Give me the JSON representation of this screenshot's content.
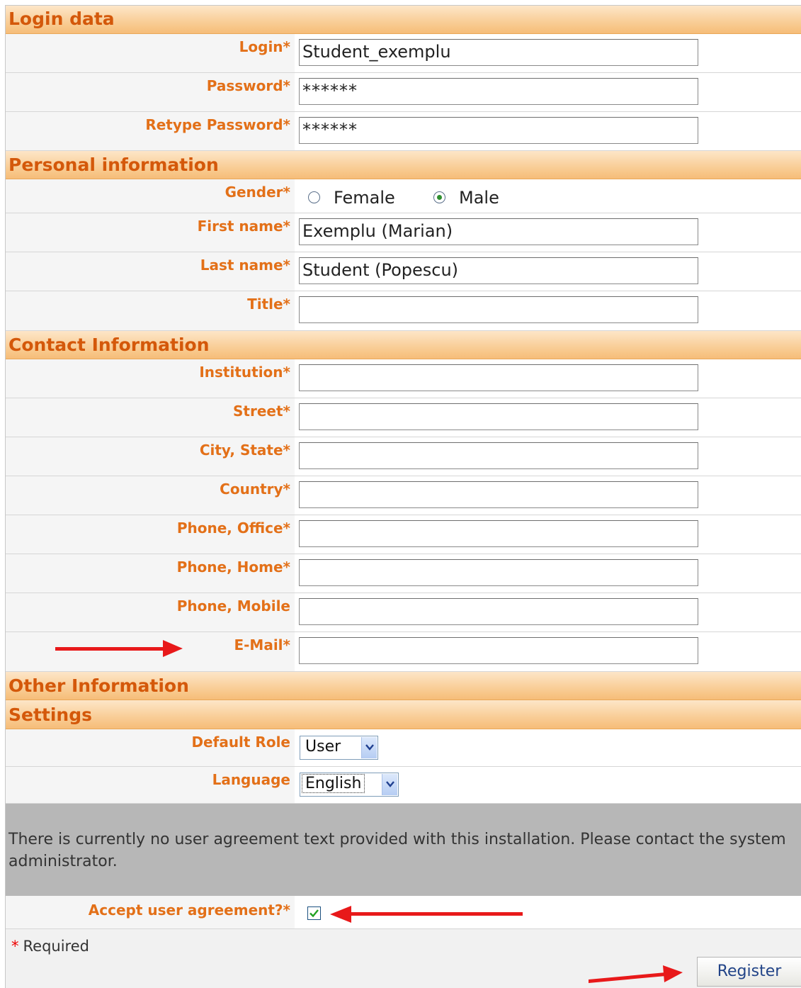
{
  "sections": {
    "login": "Login data",
    "personal": "Personal information",
    "contact": "Contact Information",
    "other": "Other Information",
    "settings": "Settings"
  },
  "login": {
    "login_label": "Login*",
    "login_value": "Student_exemplu",
    "password_label": "Password*",
    "password_value": "******",
    "retype_label": "Retype Password*",
    "retype_value": "******"
  },
  "personal": {
    "gender_label": "Gender*",
    "gender_options": [
      "Female",
      "Male"
    ],
    "gender_selected": "Male",
    "first_name_label": "First name*",
    "first_name_value": "Exemplu (Marian)",
    "last_name_label": "Last name*",
    "last_name_value": "Student (Popescu)",
    "title_label": "Title*",
    "title_value": ""
  },
  "contact": {
    "institution_label": "Institution*",
    "street_label": "Street*",
    "city_label": "City, State*",
    "country_label": "Country*",
    "phone_office_label": "Phone, Office*",
    "phone_home_label": "Phone, Home*",
    "phone_mobile_label": "Phone, Mobile",
    "email_label": "E-Mail*"
  },
  "settings": {
    "role_label": "Default Role",
    "role_value": "User",
    "language_label": "Language",
    "language_value": "English"
  },
  "agreement": {
    "text": "There is currently no user agreement text provided with this installation. Please contact the system administrator.",
    "accept_label": "Accept user agreement?*",
    "accepted": true
  },
  "footer": {
    "required_star": "*",
    "required_text": "Required",
    "register_label": "Register"
  },
  "colors": {
    "label": "#e37018",
    "section_text": "#d4580a",
    "arrow": "#e8191a"
  }
}
